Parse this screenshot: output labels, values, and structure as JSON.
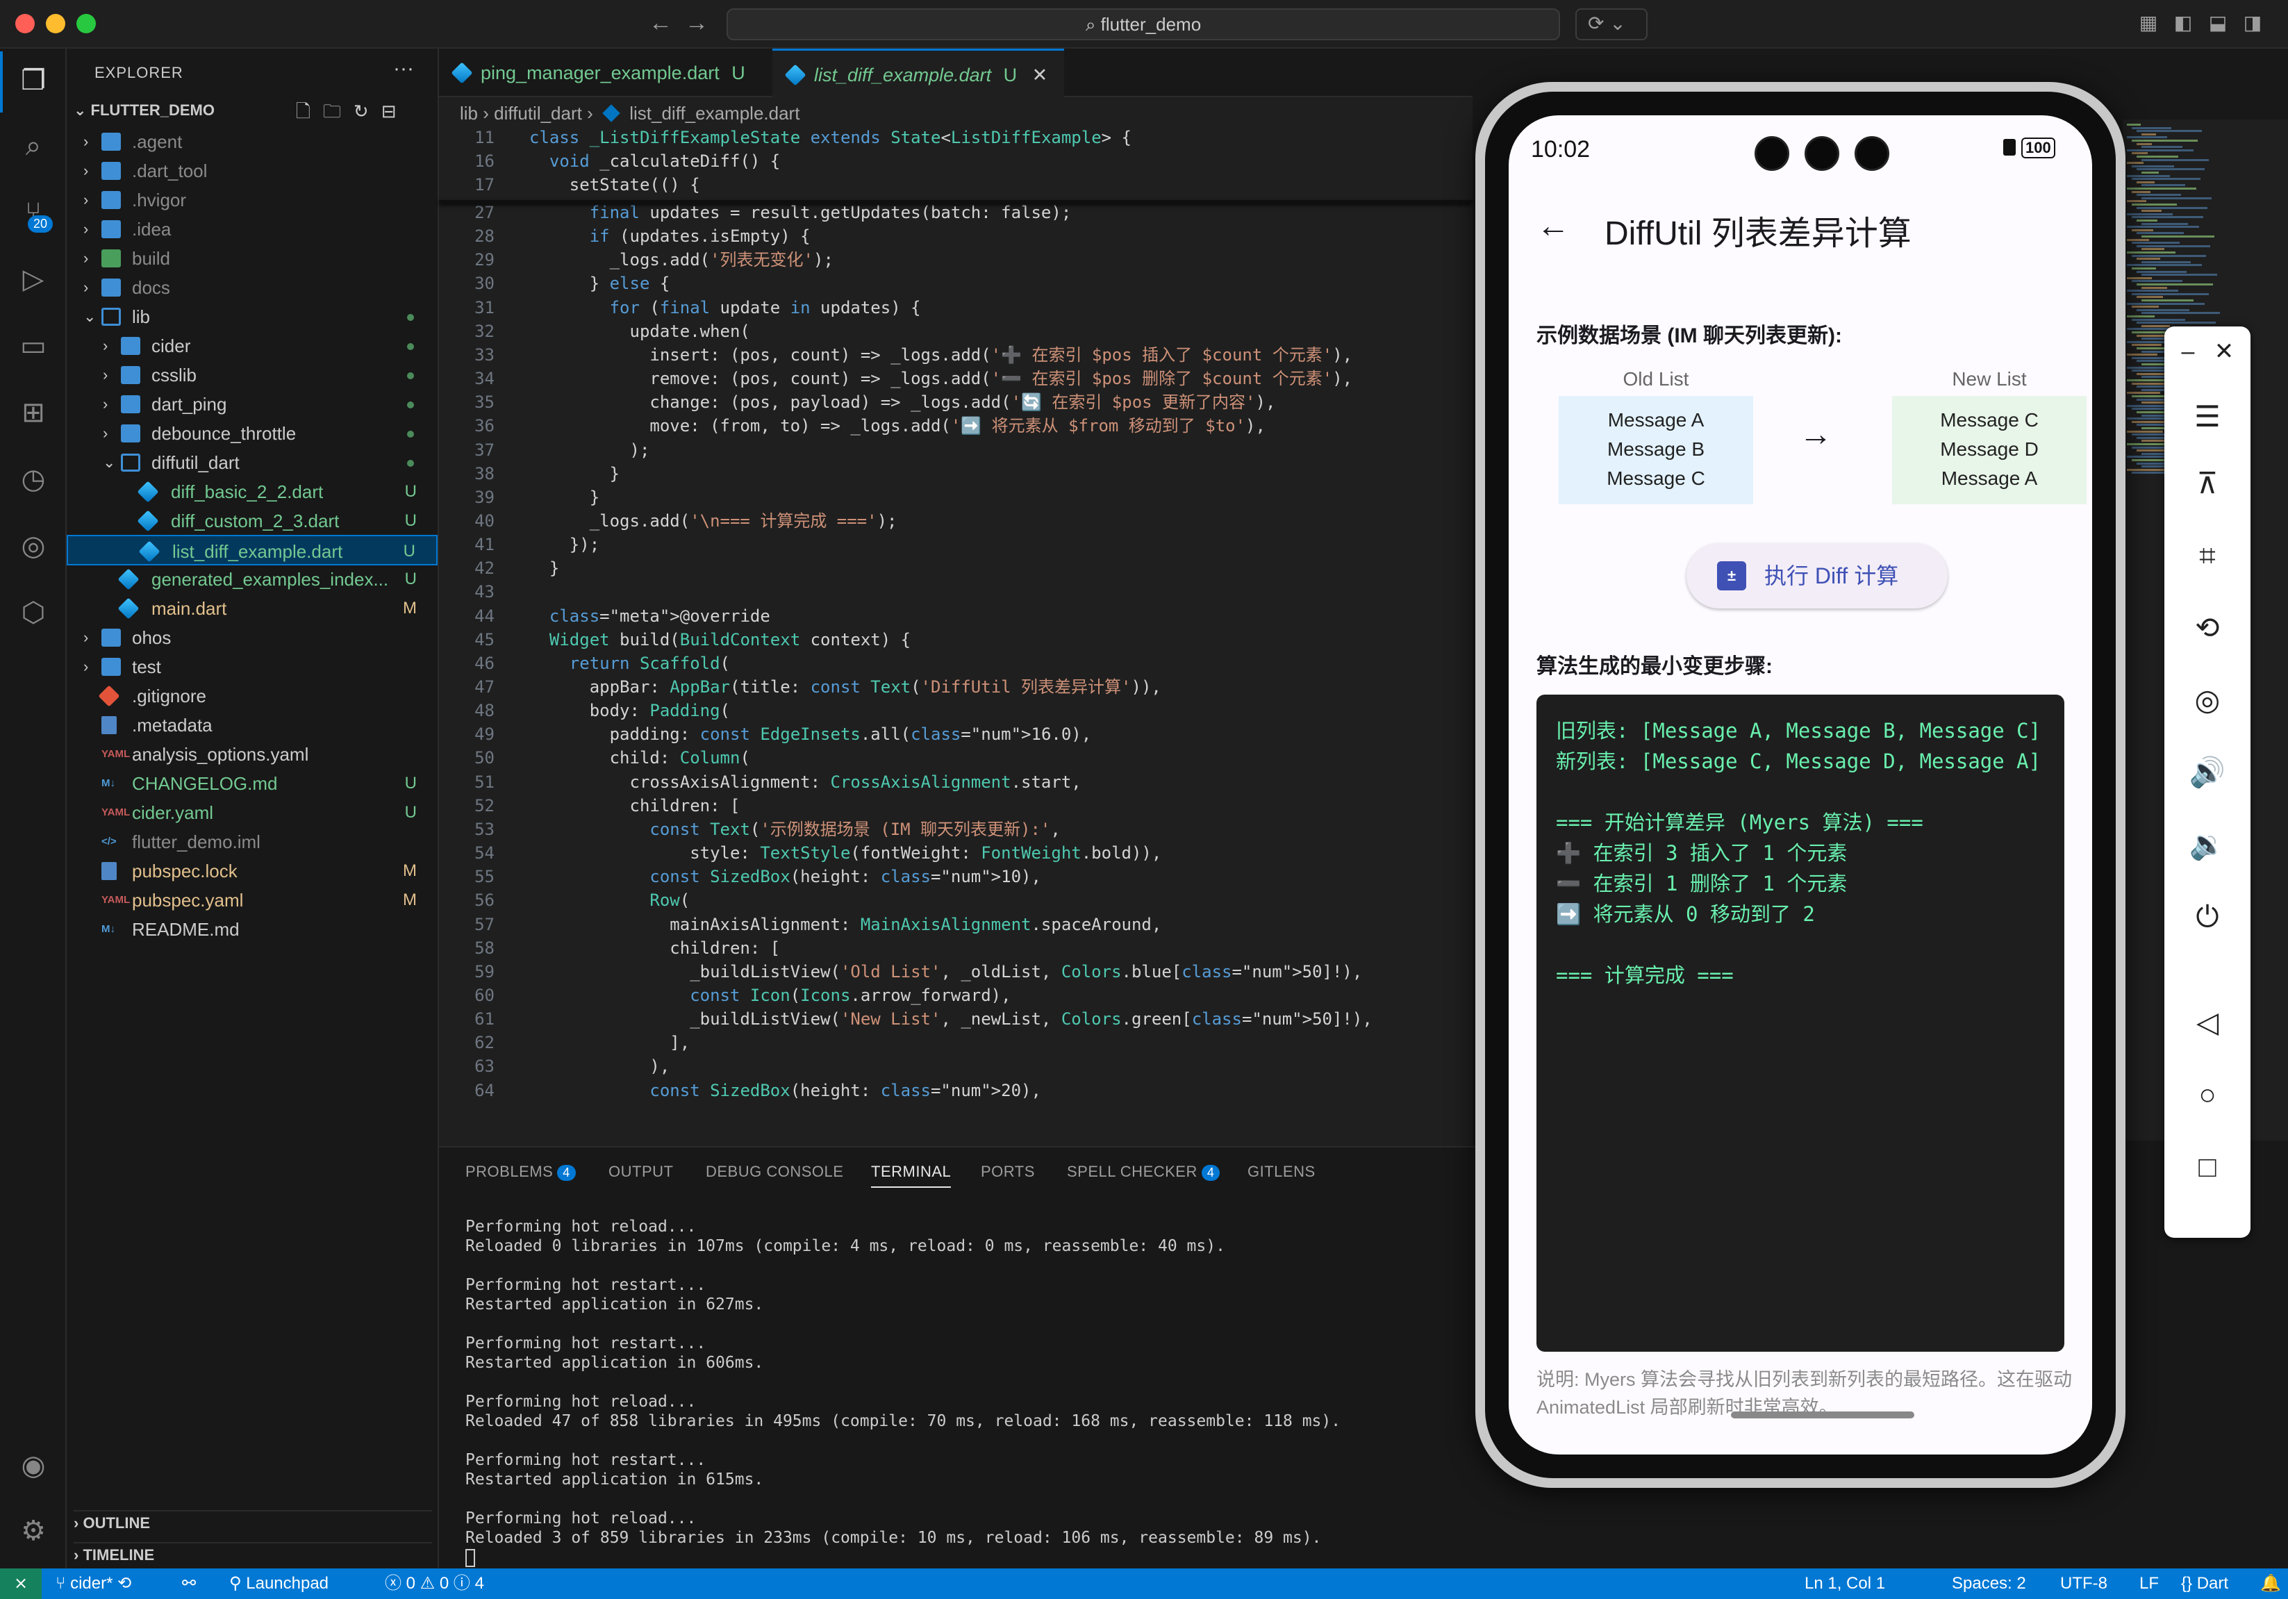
{
  "titlebar": {
    "search": "flutter_demo"
  },
  "activity": {
    "scm_badge": "20"
  },
  "explorer": {
    "header": "EXPLORER",
    "more": "···",
    "project": "FLUTTER_DEMO",
    "items": [
      {
        "label": ".agent",
        "kind": "folder",
        "depth": 0
      },
      {
        "label": ".dart_tool",
        "kind": "folder",
        "depth": 0
      },
      {
        "label": ".hvigor",
        "kind": "folder",
        "depth": 0
      },
      {
        "label": ".idea",
        "kind": "folder",
        "depth": 0
      },
      {
        "label": "build",
        "kind": "folder-build",
        "depth": 0
      },
      {
        "label": "docs",
        "kind": "folder",
        "depth": 0
      },
      {
        "label": "lib",
        "kind": "folder-open",
        "depth": 0
      },
      {
        "label": "cider",
        "kind": "folder",
        "depth": 1
      },
      {
        "label": "csslib",
        "kind": "folder",
        "depth": 1
      },
      {
        "label": "dart_ping",
        "kind": "folder",
        "depth": 1
      },
      {
        "label": "debounce_throttle",
        "kind": "folder",
        "depth": 1
      },
      {
        "label": "diffutil_dart",
        "kind": "folder-open",
        "depth": 1
      },
      {
        "label": "diff_basic_2_2.dart",
        "kind": "dart",
        "depth": 2,
        "status": "U"
      },
      {
        "label": "diff_custom_2_3.dart",
        "kind": "dart",
        "depth": 2,
        "status": "U"
      },
      {
        "label": "list_diff_example.dart",
        "kind": "dart",
        "depth": 2,
        "status": "U"
      },
      {
        "label": "generated_examples_index...",
        "kind": "dart",
        "depth": 1,
        "status": "U"
      },
      {
        "label": "main.dart",
        "kind": "dart",
        "depth": 1,
        "status": "M"
      },
      {
        "label": "ohos",
        "kind": "folder",
        "depth": 0
      },
      {
        "label": "test",
        "kind": "folder",
        "depth": 0
      },
      {
        "label": ".gitignore",
        "kind": "git",
        "depth": 0
      },
      {
        "label": ".metadata",
        "kind": "file",
        "depth": 0
      },
      {
        "label": "analysis_options.yaml",
        "kind": "yaml",
        "depth": 0
      },
      {
        "label": "CHANGELOG.md",
        "kind": "md",
        "depth": 0,
        "status": "U"
      },
      {
        "label": "cider.yaml",
        "kind": "yaml",
        "depth": 0,
        "status": "U"
      },
      {
        "label": "flutter_demo.iml",
        "kind": "xml",
        "depth": 0
      },
      {
        "label": "pubspec.lock",
        "kind": "file",
        "depth": 0,
        "status": "M"
      },
      {
        "label": "pubspec.yaml",
        "kind": "yaml",
        "depth": 0,
        "status": "M"
      },
      {
        "label": "README.md",
        "kind": "md",
        "depth": 0
      }
    ],
    "outline": "OUTLINE",
    "timeline": "TIMELINE"
  },
  "editor": {
    "tabs": [
      {
        "label": "ping_manager_example.dart",
        "status": "U"
      },
      {
        "label": "list_diff_example.dart",
        "status": "U",
        "close": "✕"
      }
    ],
    "breadcrumb": [
      "lib",
      "diffutil_dart",
      "list_diff_example.dart"
    ],
    "lines": [
      {
        "n": "11",
        "t": "class _ListDiffExampleState extends State<ListDiffExample> {"
      },
      {
        "n": "16",
        "t": "  void _calculateDiff() {"
      },
      {
        "n": "17",
        "t": "    setState(() {"
      },
      {
        "n": "27",
        "t": "      final updates = result.getUpdates(batch: false);"
      },
      {
        "n": "28",
        "t": "      if (updates.isEmpty) {"
      },
      {
        "n": "29",
        "t": "        _logs.add('列表无变化');"
      },
      {
        "n": "30",
        "t": "      } else {"
      },
      {
        "n": "31",
        "t": "        for (final update in updates) {"
      },
      {
        "n": "32",
        "t": "          update.when("
      },
      {
        "n": "33",
        "t": "            insert: (pos, count) => _logs.add('➕ 在索引 $pos 插入了 $count 个元素'),"
      },
      {
        "n": "34",
        "t": "            remove: (pos, count) => _logs.add('➖ 在索引 $pos 删除了 $count 个元素'),"
      },
      {
        "n": "35",
        "t": "            change: (pos, payload) => _logs.add('🔄 在索引 $pos 更新了内容'),"
      },
      {
        "n": "36",
        "t": "            move: (from, to) => _logs.add('➡️ 将元素从 $from 移动到了 $to'),"
      },
      {
        "n": "37",
        "t": "          );"
      },
      {
        "n": "38",
        "t": "        }"
      },
      {
        "n": "39",
        "t": "      }"
      },
      {
        "n": "40",
        "t": "      _logs.add('\\n=== 计算完成 ===');"
      },
      {
        "n": "41",
        "t": "    });"
      },
      {
        "n": "42",
        "t": "  }"
      },
      {
        "n": "43",
        "t": ""
      },
      {
        "n": "44",
        "t": "  @override"
      },
      {
        "n": "45",
        "t": "  Widget build(BuildContext context) {"
      },
      {
        "n": "46",
        "t": "    return Scaffold("
      },
      {
        "n": "47",
        "t": "      appBar: AppBar(title: const Text('DiffUtil 列表差异计算')),"
      },
      {
        "n": "48",
        "t": "      body: Padding("
      },
      {
        "n": "49",
        "t": "        padding: const EdgeInsets.all(16.0),"
      },
      {
        "n": "50",
        "t": "        child: Column("
      },
      {
        "n": "51",
        "t": "          crossAxisAlignment: CrossAxisAlignment.start,"
      },
      {
        "n": "52",
        "t": "          children: ["
      },
      {
        "n": "53",
        "t": "            const Text('示例数据场景 (IM 聊天列表更新):',"
      },
      {
        "n": "54",
        "t": "                style: TextStyle(fontWeight: FontWeight.bold)),"
      },
      {
        "n": "55",
        "t": "            const SizedBox(height: 10),"
      },
      {
        "n": "56",
        "t": "            Row("
      },
      {
        "n": "57",
        "t": "              mainAxisAlignment: MainAxisAlignment.spaceAround,"
      },
      {
        "n": "58",
        "t": "              children: ["
      },
      {
        "n": "59",
        "t": "                _buildListView('Old List', _oldList, Colors.blue[50]!),"
      },
      {
        "n": "60",
        "t": "                const Icon(Icons.arrow_forward),"
      },
      {
        "n": "61",
        "t": "                _buildListView('New List', _newList, Colors.green[50]!),"
      },
      {
        "n": "62",
        "t": "              ],"
      },
      {
        "n": "63",
        "t": "            ),"
      },
      {
        "n": "64",
        "t": "            const SizedBox(height: 20),"
      }
    ]
  },
  "panel": {
    "tabs": [
      {
        "label": "PROBLEMS",
        "badge": "4"
      },
      {
        "label": "OUTPUT"
      },
      {
        "label": "DEBUG CONSOLE"
      },
      {
        "label": "TERMINAL",
        "active": true
      },
      {
        "label": "PORTS"
      },
      {
        "label": "SPELL CHECKER",
        "badge": "4"
      },
      {
        "label": "GITLENS"
      }
    ],
    "terminal": [
      "Performing hot reload...",
      "Reloaded 0 libraries in 107ms (compile: 4 ms, reload: 0 ms, reassemble: 40 ms).",
      "",
      "Performing hot restart...",
      "Restarted application in 627ms.",
      "",
      "Performing hot restart...",
      "Restarted application in 606ms.",
      "",
      "Performing hot reload...",
      "Reloaded 47 of 858 libraries in 495ms (compile: 70 ms, reload: 168 ms, reassemble: 118 ms).",
      "",
      "Performing hot restart...",
      "Restarted application in 615ms.",
      "",
      "Performing hot reload...",
      "Reloaded 3 of 859 libraries in 233ms (compile: 10 ms, reload: 106 ms, reassemble: 89 ms)."
    ]
  },
  "statusbar": {
    "branch": "cider*",
    "launchpad": "Launchpad",
    "errors": "0",
    "warnings": "0",
    "info": "4",
    "position": "Ln 1, Col 1",
    "spaces": "Spaces: 2",
    "encoding": "UTF-8",
    "eol": "LF",
    "language": "Dart"
  },
  "phone": {
    "time": "10:02",
    "battery": "100",
    "app_title": "DiffUtil 列表差异计算",
    "scenario_title": "示例数据场景 (IM 聊天列表更新):",
    "old_caption": "Old List",
    "new_caption": "New List",
    "old_items": [
      "Message A",
      "Message B",
      "Message C"
    ],
    "new_items": [
      "Message C",
      "Message D",
      "Message A"
    ],
    "button_label": "执行 Diff 计算",
    "steps_title": "算法生成的最小变更步骤:",
    "log": [
      "旧列表: [Message A, Message B, Message C]",
      "新列表: [Message C, Message D, Message A]",
      "",
      "=== 开始计算差异 (Myers 算法) ===",
      "➕ 在索引 3 插入了 1 个元素",
      "➖ 在索引 1 删除了 1 个元素",
      "➡️ 将元素从 0 移动到了 2",
      "",
      "=== 计算完成 ==="
    ],
    "note": "说明: Myers 算法会寻找从旧列表到新列表的最短路径。这在驱动 AnimatedList 局部刷新时非常高效。",
    "old_color": "#e3f2fd",
    "new_color": "#e8f5e9"
  }
}
